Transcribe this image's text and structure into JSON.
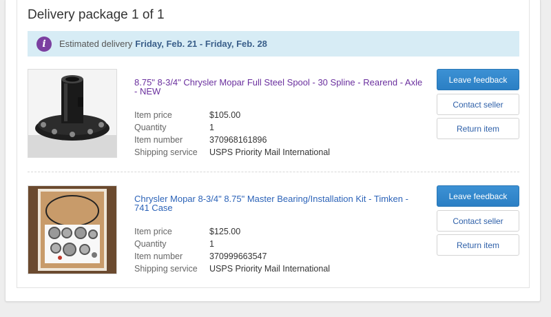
{
  "package": {
    "title": "Delivery package 1 of 1",
    "estimated_label": "Estimated delivery",
    "estimated_dates": "Friday, Feb. 21 - Friday, Feb. 28",
    "info_icon": "info-icon"
  },
  "detail_labels": {
    "price": "Item price",
    "quantity": "Quantity",
    "number": "Item number",
    "shipping": "Shipping service"
  },
  "buttons": {
    "leave_feedback": "Leave feedback",
    "contact_seller": "Contact seller",
    "return_item": "Return item"
  },
  "items": [
    {
      "title": "8.75\" 8-3/4\" Chrysler Mopar Full Steel Spool - 30 Spline - Rearend - Axle - NEW",
      "price": "$105.00",
      "quantity": "1",
      "number": "370968161896",
      "shipping": "USPS Priority Mail International"
    },
    {
      "title": "Chrysler Mopar 8-3/4\" 8.75\" Master Bearing/Installation Kit - Timken - 741 Case",
      "price": "$125.00",
      "quantity": "1",
      "number": "370999663547",
      "shipping": "USPS Priority Mail International"
    }
  ],
  "colors": {
    "banner_bg": "#d7ecf5",
    "info_icon": "#7b3fa0",
    "primary_button": "#2f86cc",
    "visited_link": "#6a2f9e",
    "link": "#2c63b8"
  }
}
